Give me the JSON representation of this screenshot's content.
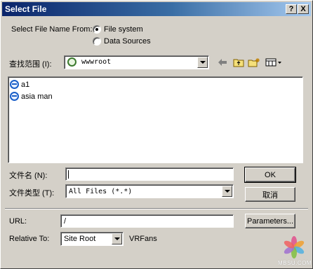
{
  "window": {
    "title": "Select File",
    "help_label": "?",
    "close_label": "X"
  },
  "select_from": {
    "label": "Select File Name From:",
    "options": [
      {
        "label": "File system",
        "checked": true
      },
      {
        "label": "Data Sources",
        "checked": false
      }
    ]
  },
  "lookin": {
    "label": "查找范围 (I):",
    "value": "wwwroot"
  },
  "toolbar": {
    "back_icon": "back-arrow-icon",
    "up_icon": "up-folder-icon",
    "new_folder_icon": "new-folder-icon",
    "view_icon": "view-menu-icon"
  },
  "files": [
    {
      "name": "a1",
      "icon": "ie-html-icon"
    },
    {
      "name": "asia man",
      "icon": "ie-html-icon"
    }
  ],
  "filename": {
    "label": "文件名 (N):",
    "value": ""
  },
  "filetype": {
    "label": "文件类型 (T):",
    "value": "All Files (*.*)"
  },
  "buttons": {
    "ok": "OK",
    "cancel": "取消",
    "parameters": "Parameters..."
  },
  "url": {
    "label": "URL:",
    "value": "/"
  },
  "relative": {
    "label": "Relative To:",
    "value": "Site Root",
    "site": "VRFans"
  },
  "watermark": {
    "text": "MBSU.COM"
  }
}
